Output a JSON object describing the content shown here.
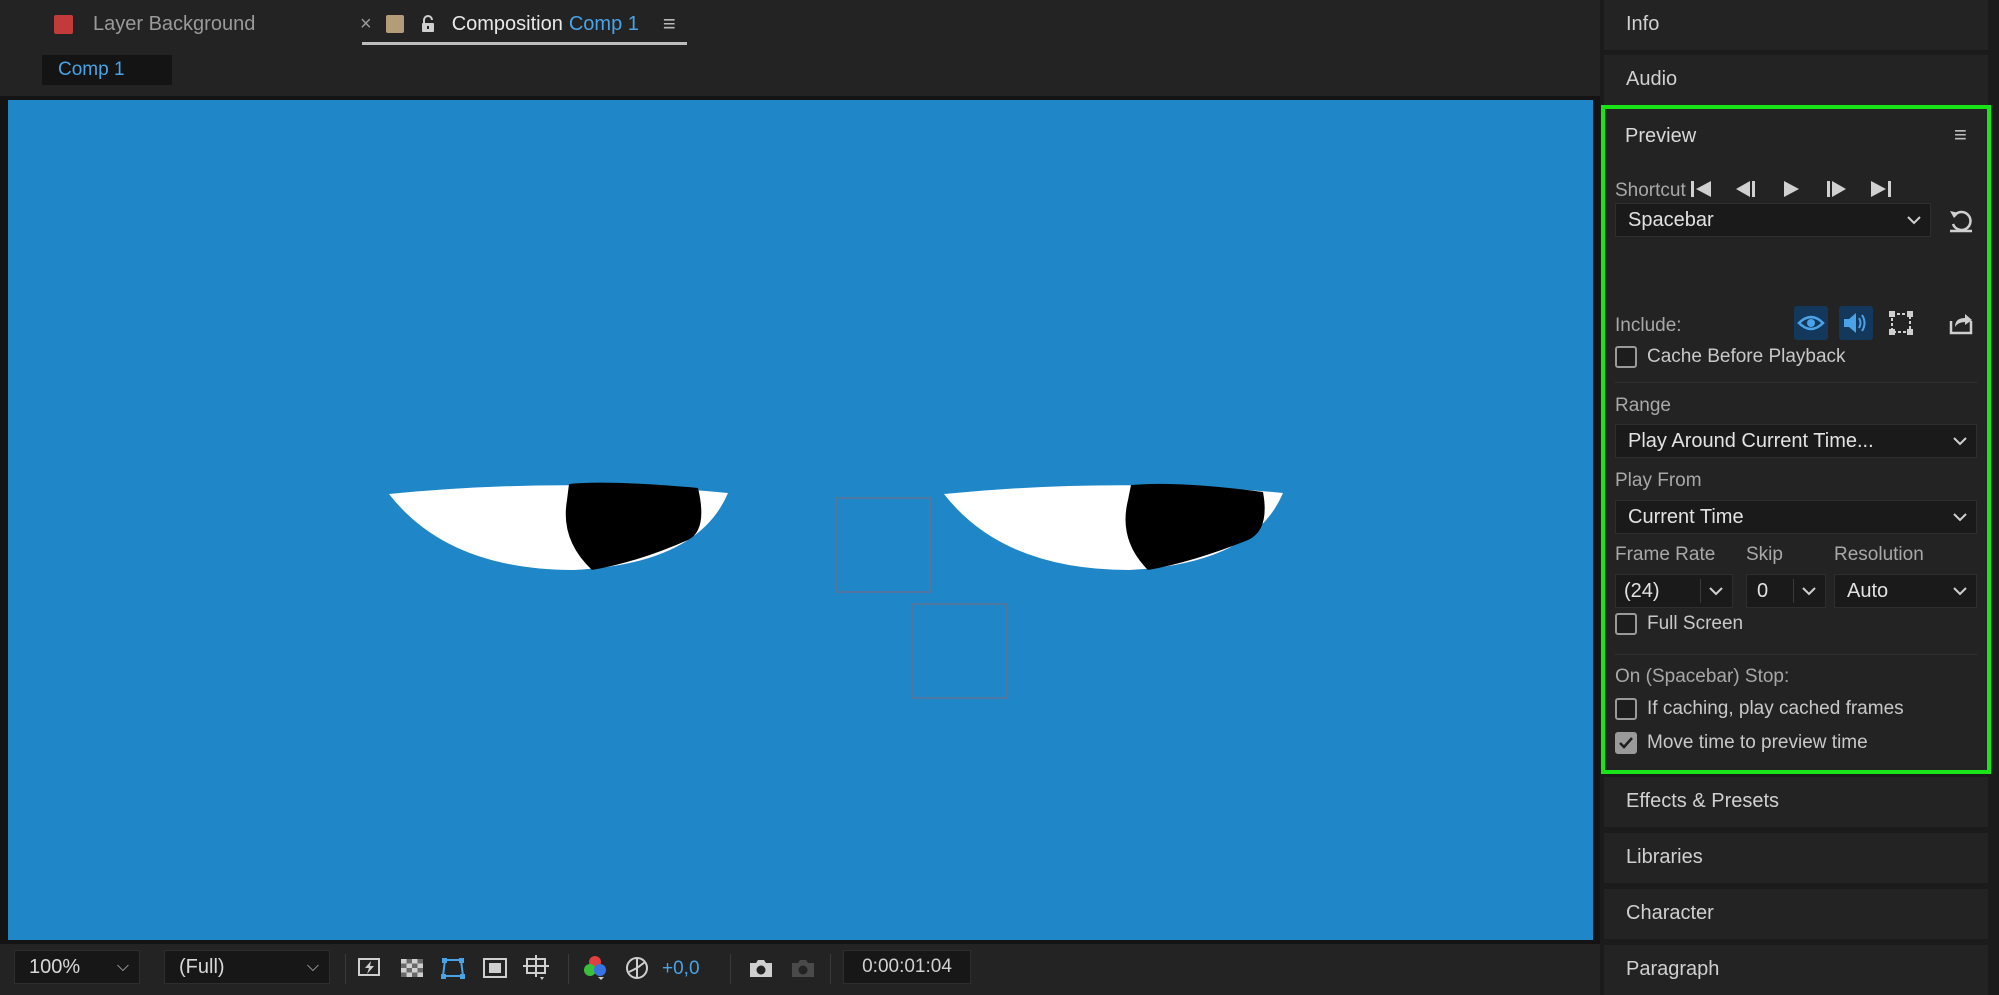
{
  "tabs": {
    "layer": {
      "label": "Layer Background",
      "color": "#c23a3a"
    },
    "composition": {
      "prefix": "Composition",
      "name": "Comp 1",
      "color": "#b59c79"
    }
  },
  "breadcrumb": "Comp 1",
  "canvas": {
    "background": "#1f86c8"
  },
  "viewer_toolbar": {
    "zoom": "100%",
    "resolution": "(Full)",
    "exposure": "+0,0",
    "timecode": "0:00:01:04"
  },
  "panels": {
    "info": "Info",
    "audio": "Audio",
    "effects": "Effects & Presets",
    "libraries": "Libraries",
    "character": "Character",
    "paragraph": "Paragraph"
  },
  "preview": {
    "title": "Preview",
    "shortcut_label": "Shortcut",
    "shortcut_value": "Spacebar",
    "include_label": "Include:",
    "cache_before_playback": {
      "label": "Cache Before Playback",
      "checked": false
    },
    "range_label": "Range",
    "range_value": "Play Around Current Time...",
    "play_from_label": "Play From",
    "play_from_value": "Current Time",
    "frame_rate_label": "Frame Rate",
    "frame_rate_value": "(24)",
    "skip_label": "Skip",
    "skip_value": "0",
    "resolution_label": "Resolution",
    "resolution_value": "Auto",
    "full_screen": {
      "label": "Full Screen",
      "checked": false
    },
    "on_stop_label": "On (Spacebar) Stop:",
    "if_caching": {
      "label": "If caching, play cached frames",
      "checked": false
    },
    "move_time": {
      "label": "Move time to preview time",
      "checked": true
    },
    "highlight_color": "#18e418",
    "accent_color": "#49a3e6"
  }
}
